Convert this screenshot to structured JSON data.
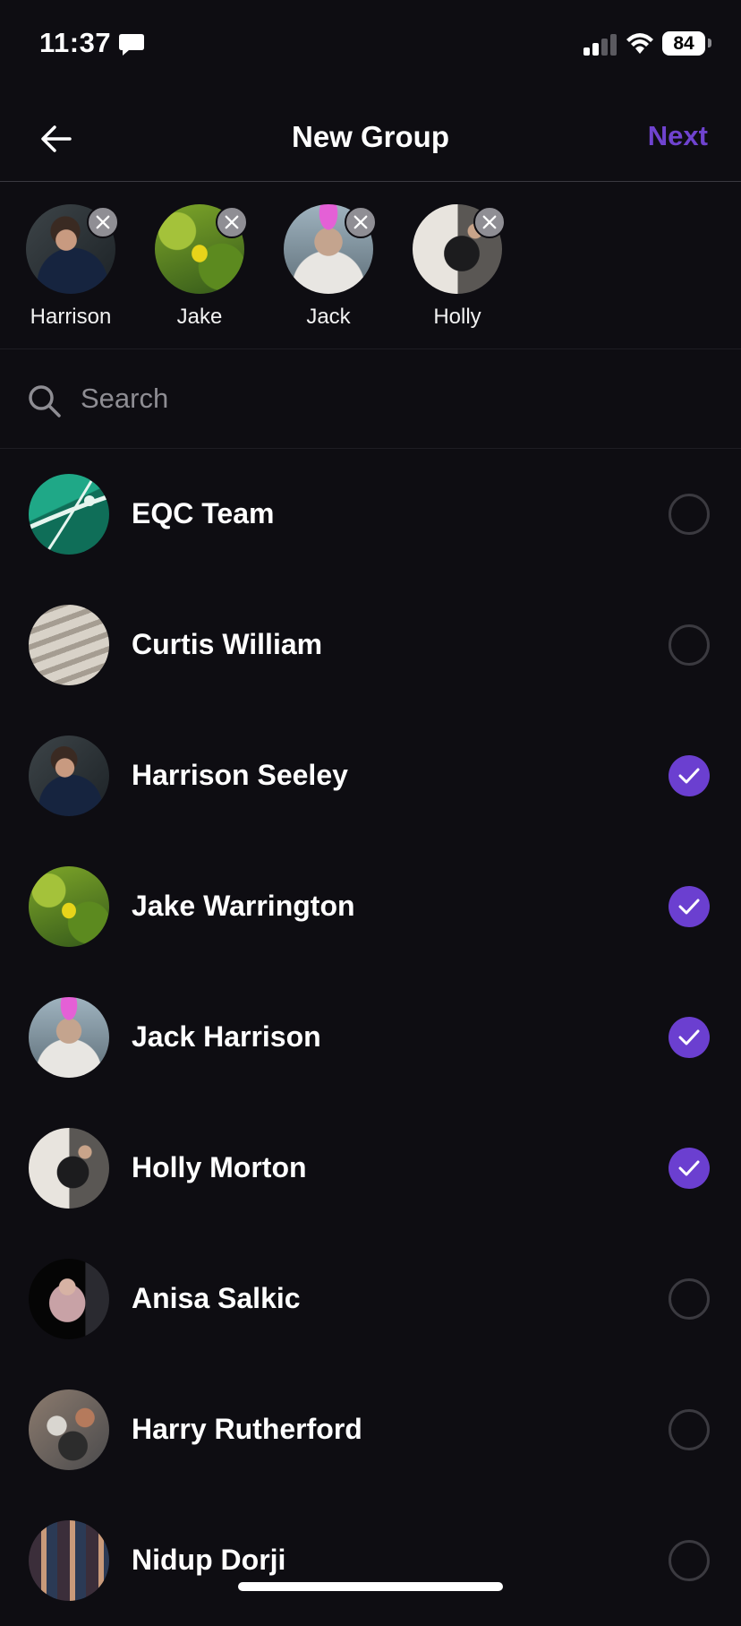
{
  "status_bar": {
    "time": "11:37",
    "battery": "84"
  },
  "header": {
    "title": "New Group",
    "next_label": "Next"
  },
  "selected": [
    {
      "name": "Harrison",
      "avatar": "harrison"
    },
    {
      "name": "Jake",
      "avatar": "jake"
    },
    {
      "name": "Jack",
      "avatar": "jack"
    },
    {
      "name": "Holly",
      "avatar": "holly"
    }
  ],
  "search": {
    "placeholder": "Search"
  },
  "contacts": [
    {
      "name": "EQC Team",
      "checked": false,
      "avatar": "eqc"
    },
    {
      "name": "Curtis William",
      "checked": false,
      "avatar": "curtis"
    },
    {
      "name": "Harrison Seeley",
      "checked": true,
      "avatar": "harrison"
    },
    {
      "name": "Jake Warrington",
      "checked": true,
      "avatar": "jake"
    },
    {
      "name": "Jack Harrison",
      "checked": true,
      "avatar": "jack"
    },
    {
      "name": "Holly Morton",
      "checked": true,
      "avatar": "holly"
    },
    {
      "name": "Anisa Salkic",
      "checked": false,
      "avatar": "anisa"
    },
    {
      "name": "Harry Rutherford",
      "checked": false,
      "avatar": "harry"
    },
    {
      "name": "Nidup Dorji",
      "checked": false,
      "avatar": "nidup"
    }
  ],
  "colors": {
    "accent": "#6b3fd0",
    "background": "#0e0d12",
    "unchecked_ring": "#3b3a40"
  }
}
